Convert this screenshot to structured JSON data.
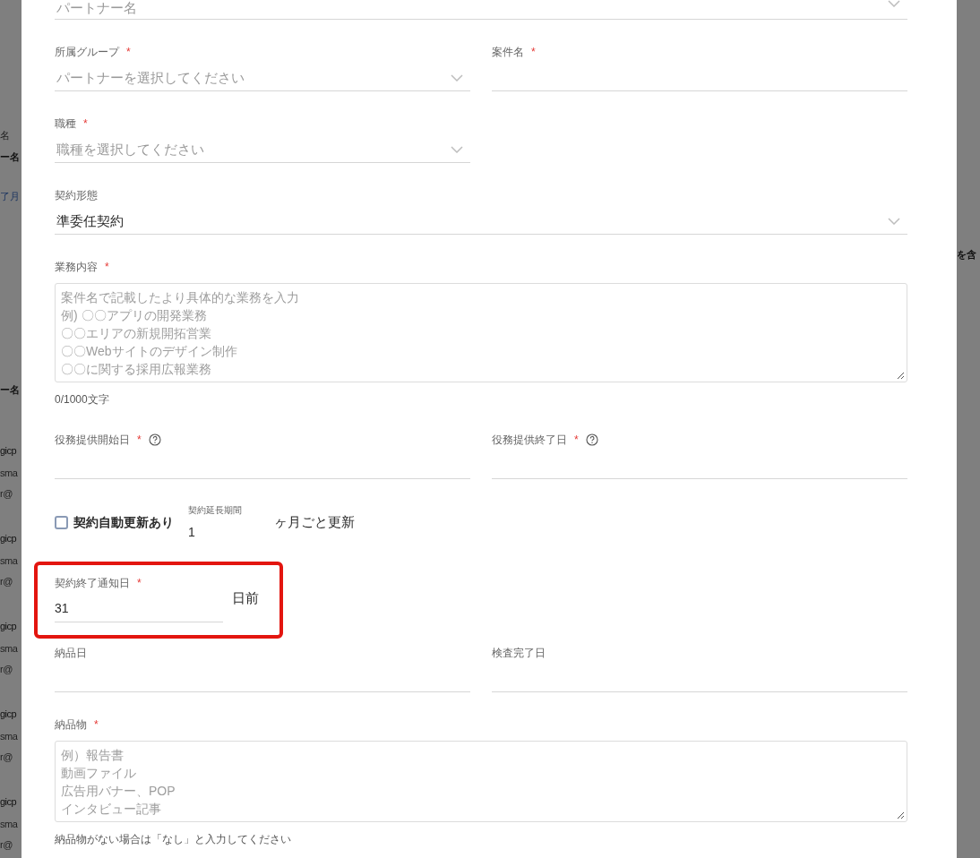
{
  "backdrop_left": [
    {
      "text": "名",
      "kind": "caption"
    },
    {
      "text": "ー名",
      "kind": "heading"
    },
    {
      "text": "了月",
      "kind": "link"
    },
    {
      "text": "ー名",
      "kind": "heading"
    },
    {
      "text": "gicp",
      "kind": "name"
    },
    {
      "text": "sma",
      "kind": "sub"
    },
    {
      "text": "r@",
      "kind": "sub"
    },
    {
      "text": "gicp",
      "kind": "name"
    },
    {
      "text": "sma",
      "kind": "sub"
    },
    {
      "text": "r@",
      "kind": "sub"
    },
    {
      "text": "gicp",
      "kind": "name"
    },
    {
      "text": "sma",
      "kind": "sub"
    },
    {
      "text": "r@",
      "kind": "sub"
    },
    {
      "text": "gicp",
      "kind": "name"
    },
    {
      "text": "sma",
      "kind": "sub"
    },
    {
      "text": "r@",
      "kind": "sub"
    },
    {
      "text": "gicp",
      "kind": "name"
    },
    {
      "text": "sma",
      "kind": "sub"
    },
    {
      "text": "r@",
      "kind": "sub"
    }
  ],
  "backdrop_right": [
    {
      "text": "を含",
      "kind": "heading"
    }
  ],
  "form": {
    "rows": [
      {
        "kind": "top",
        "fields": [
          {
            "kind": "select",
            "placeholder": "パートナー名"
          }
        ]
      },
      {
        "kind": "pair",
        "fields": [
          {
            "kind": "select",
            "label": "所属グループ",
            "required_mark": "*",
            "placeholder": "パートナーを選択してください"
          },
          {
            "kind": "text",
            "label": "案件名",
            "required_mark": "*"
          }
        ]
      },
      {
        "kind": "pair",
        "fields": [
          {
            "kind": "select",
            "label": "職種",
            "required_mark": "*",
            "placeholder": "職種を選択してください"
          }
        ]
      },
      {
        "kind": "full",
        "fields": [
          {
            "kind": "select",
            "label": "契約形態",
            "value": "準委任契約"
          }
        ]
      },
      {
        "kind": "full",
        "fields": [
          {
            "kind": "textarea",
            "label": "業務内容",
            "required_mark": "*",
            "placeholder": [
              "案件名で記載したより具体的な業務を入力",
              "例) 〇〇アプリの開発業務",
              "〇〇エリアの新規開拓営業",
              "〇〇Webサイトのデザイン制作",
              "〇〇に関する採用広報業務"
            ],
            "helper": "0/1000文字"
          }
        ]
      },
      {
        "kind": "pair",
        "fields": [
          {
            "kind": "date",
            "label": "役務提供開始日",
            "required_mark": "*",
            "help": true
          },
          {
            "kind": "date",
            "label": "役務提供終了日",
            "required_mark": "*",
            "help": true
          }
        ]
      },
      {
        "kind": "renewal",
        "checkbox": {
          "label": "契約自動更新あり",
          "checked": false
        },
        "period": {
          "label": "契約延長期間",
          "value": "1",
          "suffix": "ヶ月ごと更新"
        }
      },
      {
        "kind": "notice",
        "highlighted": true,
        "field": {
          "label": "契約終了通知日",
          "required_mark": "*",
          "value": "31",
          "suffix": "日前"
        }
      },
      {
        "kind": "pair",
        "fields": [
          {
            "kind": "date",
            "label": "納品日"
          },
          {
            "kind": "date",
            "label": "検査完了日"
          }
        ]
      },
      {
        "kind": "full",
        "fields": [
          {
            "kind": "textarea",
            "label": "納品物",
            "required_mark": "*",
            "placeholder": [
              "例）報告書",
              "動画ファイル",
              "広告用バナー、POP",
              "インタビュー記事"
            ],
            "helper": "納品物がない場合は「なし」と入力してください"
          }
        ]
      }
    ]
  }
}
